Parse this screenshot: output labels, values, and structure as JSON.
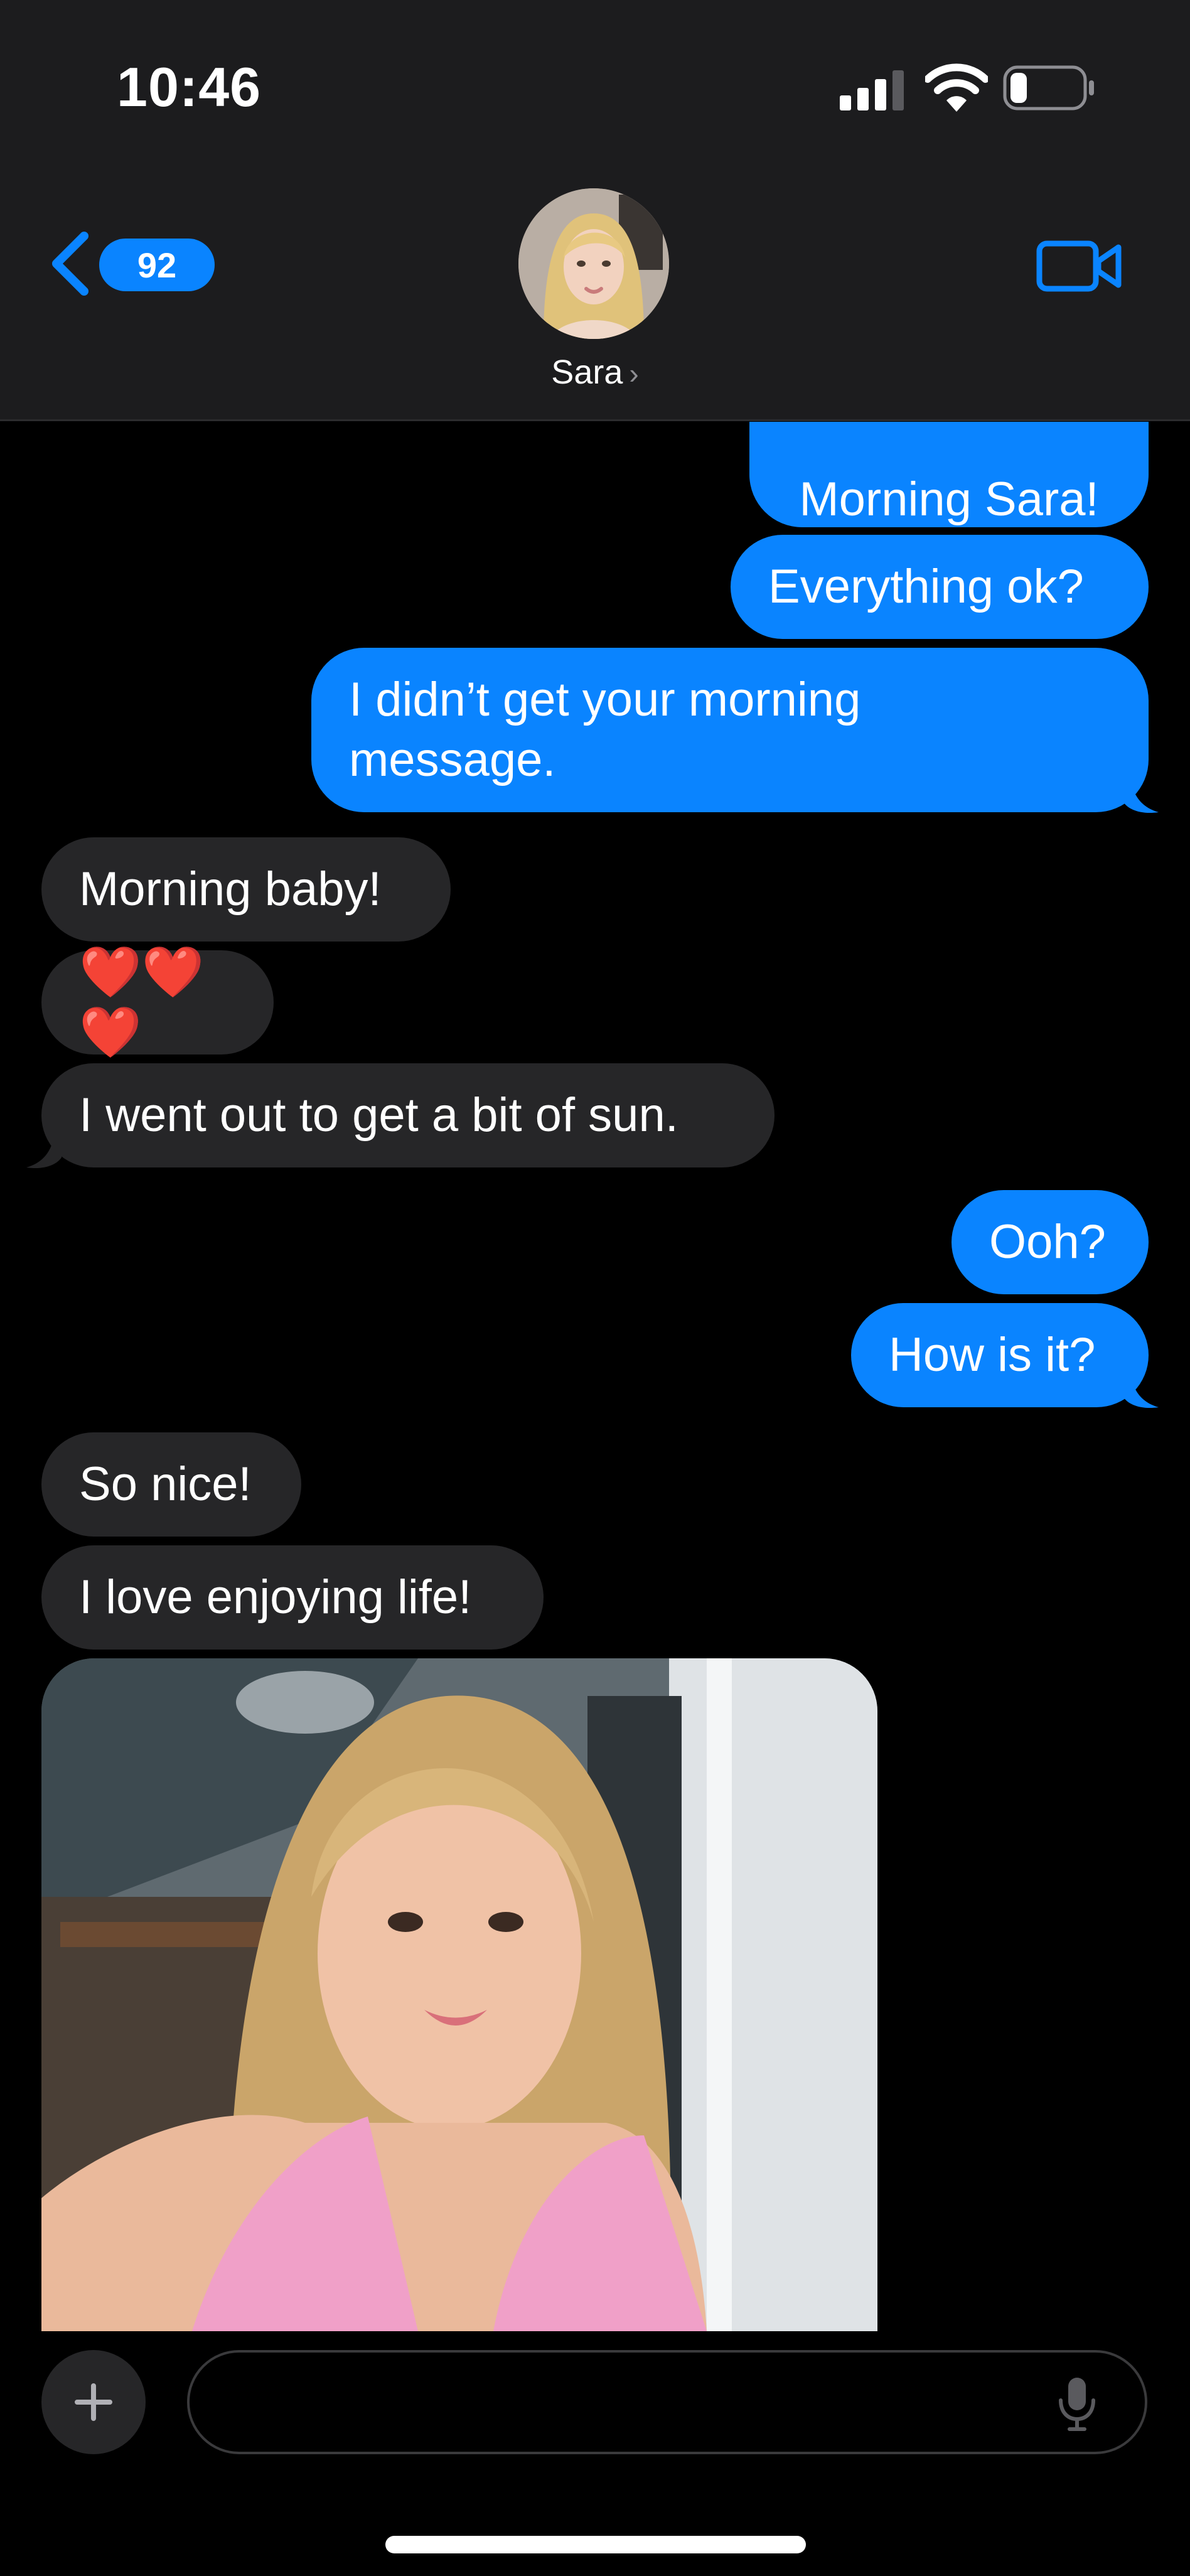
{
  "status_bar": {
    "time": "10:46"
  },
  "header": {
    "back_badge": "92",
    "contact_name": "Sara",
    "contact_chevron": "›"
  },
  "messages": [
    {
      "side": "sent",
      "text": "Morning Sara!"
    },
    {
      "side": "sent",
      "text": "Everything ok?"
    },
    {
      "side": "sent",
      "text": "I didn’t get your morning message."
    },
    {
      "side": "received",
      "text": "Morning baby!"
    },
    {
      "side": "received",
      "text": "❤️❤️❤️"
    },
    {
      "side": "received",
      "text": "I went out to get a bit of sun."
    },
    {
      "side": "sent",
      "text": "Ooh?"
    },
    {
      "side": "sent",
      "text": "How is it?"
    },
    {
      "side": "received",
      "text": "So nice!"
    },
    {
      "side": "received",
      "text": "I love enjoying life!"
    }
  ],
  "composer": {
    "placeholder": ""
  },
  "colors": {
    "sent_bubble": "#0a84ff",
    "received_bubble": "#262628",
    "header_bg": "#1c1c1e",
    "background": "#000000"
  },
  "icons": [
    "back-chevron-icon",
    "video-call-icon",
    "signal-icon",
    "wifi-icon",
    "battery-icon",
    "plus-icon",
    "microphone-icon"
  ]
}
